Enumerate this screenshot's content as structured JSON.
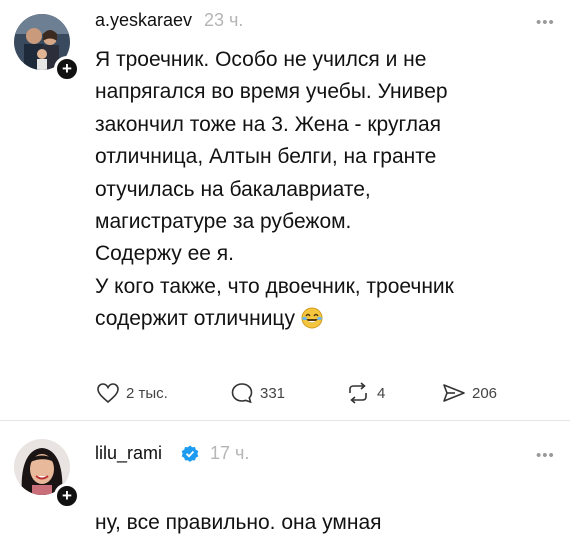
{
  "post1": {
    "username": "a.yeskaraev",
    "time": "23 ч.",
    "text": "Я троечник. Особо не учился и не\nнапрягался во время учебы. Универ\nзакончил тоже на 3. Жена - круглая\nотличница, Алтын белги, на гранте\nотучилась на бакалавриате,\nмагистратуре за рубежом.\nСодержу ее я.\nУ кого также, что двоечник, троечник\nсодержит отличницу",
    "emoji": "face-with-tears-of-joy",
    "actions": {
      "likes": "2 тыс.",
      "comments": "331",
      "reposts": "4",
      "shares": "206"
    }
  },
  "post2": {
    "username": "lilu_rami",
    "time": "17 ч.",
    "text": "ну, все правильно. она умная"
  },
  "more_icon": "•••",
  "colors": {
    "text": "#121212",
    "muted": "#b5b5b5",
    "verified": "#1d9bf0"
  }
}
